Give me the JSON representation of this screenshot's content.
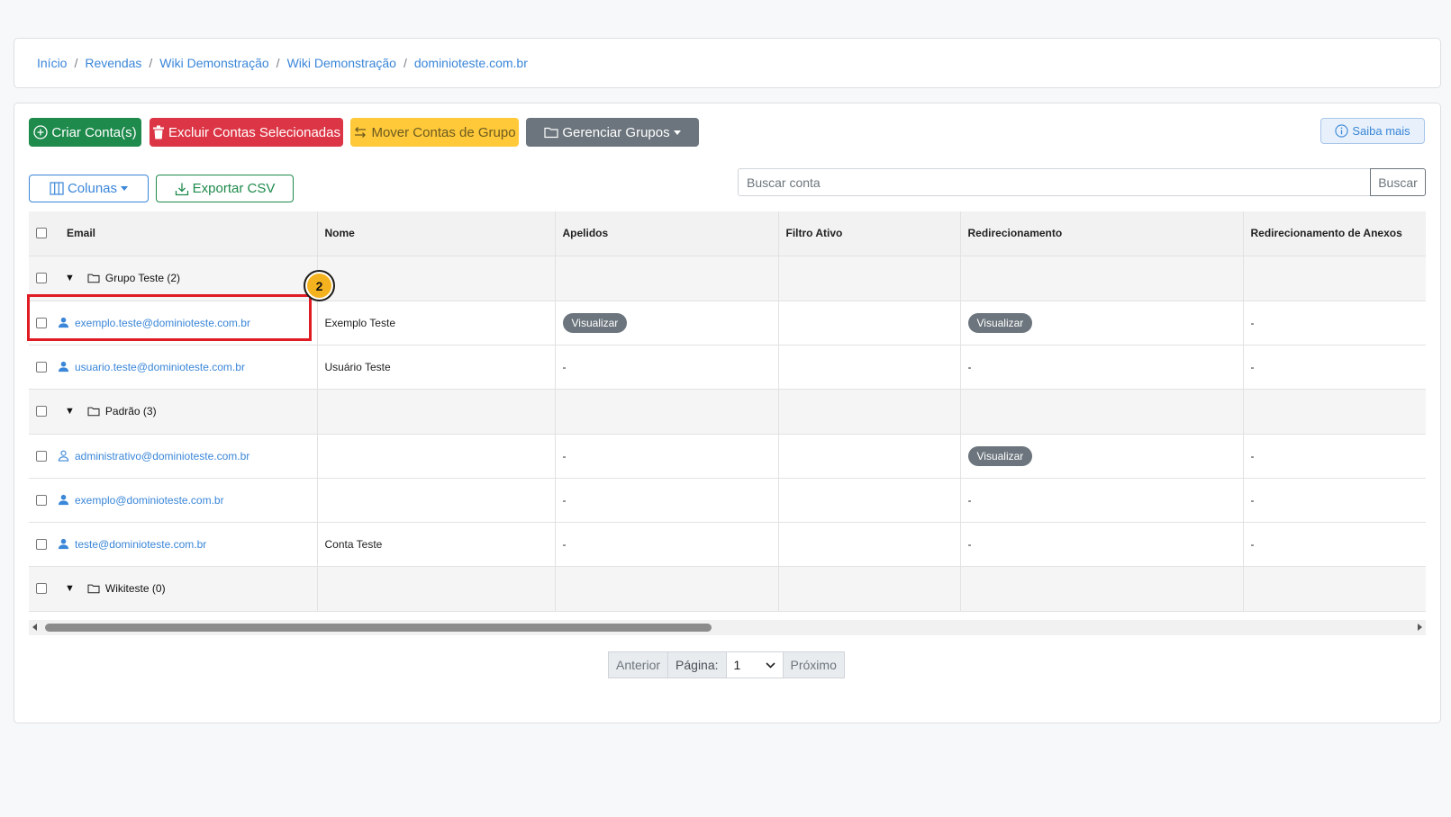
{
  "breadcrumb": [
    "Início",
    "Revendas",
    "Wiki Demonstração",
    "Wiki Demonstração",
    "dominioteste.com.br"
  ],
  "breadcrumb_separator": "/",
  "toolbar": {
    "criar": "Criar Conta(s)",
    "excluir": "Excluir Contas Selecionadas",
    "mover": "Mover Contas de Grupo",
    "grupos": "Gerenciar Grupos",
    "saiba": "Saiba mais",
    "colunas": "Colunas",
    "exportar": "Exportar CSV"
  },
  "search": {
    "placeholder": "Buscar conta",
    "button": "Buscar"
  },
  "table": {
    "columns": [
      "Email",
      "Nome",
      "Apelidos",
      "Filtro Ativo",
      "Redirecionamento",
      "Redirecionamento de Anexos"
    ],
    "rows": [
      {
        "type": "group",
        "label": "Grupo Teste (2)"
      },
      {
        "type": "account",
        "email": "exemplo.teste@dominioteste.com.br",
        "icon": "user-icon",
        "nome": "Exemplo Teste",
        "apelidos": "Visualizar",
        "filtro": "",
        "redir": "Visualizar",
        "anexos": "-"
      },
      {
        "type": "account",
        "email": "usuario.teste@dominioteste.com.br",
        "icon": "user-icon",
        "nome": "Usuário Teste",
        "apelidos": "-",
        "filtro": "",
        "redir": "-",
        "anexos": "-"
      },
      {
        "type": "group",
        "label": "Padrão (3)"
      },
      {
        "type": "account",
        "email": "administrativo@dominioteste.com.br",
        "icon": "user-outline-icon",
        "nome": "",
        "apelidos": "-",
        "filtro": "",
        "redir": "Visualizar",
        "anexos": "-"
      },
      {
        "type": "account",
        "email": "exemplo@dominioteste.com.br",
        "icon": "user-icon",
        "nome": "",
        "apelidos": "-",
        "filtro": "",
        "redir": "-",
        "anexos": "-"
      },
      {
        "type": "account",
        "email": "teste@dominioteste.com.br",
        "icon": "user-icon",
        "nome": "Conta Teste",
        "apelidos": "-",
        "filtro": "",
        "redir": "-",
        "anexos": "-"
      },
      {
        "type": "group",
        "label": "Wikiteste (0)"
      }
    ]
  },
  "pagination": {
    "prev": "Anterior",
    "label": "Página:",
    "page": "1",
    "next": "Próximo"
  },
  "annotation": {
    "step": "2"
  },
  "colors": {
    "link": "#3a86d8",
    "success": "#1e8a4c",
    "danger": "#dc3545",
    "warning": "#ffc93a",
    "secondary": "#6c757d",
    "callout": "#e01b24",
    "step_badge": "#f5b21f"
  }
}
